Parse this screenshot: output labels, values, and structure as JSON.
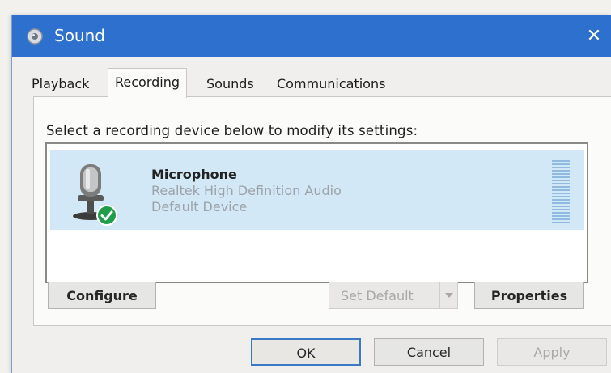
{
  "window": {
    "title": "Sound",
    "close_label": "✕"
  },
  "tabs": [
    {
      "label": "Playback",
      "active": false
    },
    {
      "label": "Recording",
      "active": true
    },
    {
      "label": "Sounds",
      "active": false
    },
    {
      "label": "Communications",
      "active": false
    }
  ],
  "recording": {
    "instruction": "Select a recording device below to modify its settings:",
    "devices": [
      {
        "name": "Microphone",
        "description": "Realtek High Definition Audio",
        "status": "Default Device",
        "icon": "microphone-icon",
        "badge_icon": "green-check-icon",
        "selected": true
      }
    ],
    "buttons": {
      "configure": "Configure",
      "set_default": "Set Default",
      "properties": "Properties"
    }
  },
  "footer": {
    "ok": "OK",
    "cancel": "Cancel",
    "apply": "Apply"
  },
  "colors": {
    "titlebar": "#2e70cd",
    "selection": "#d3e8f7",
    "check_badge": "#1f9d4a"
  }
}
